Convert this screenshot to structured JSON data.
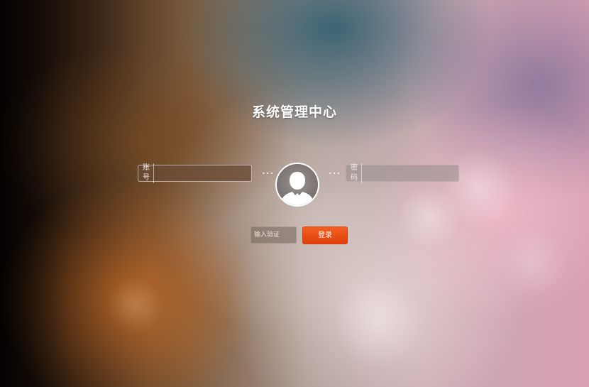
{
  "page": {
    "title": "系统管理中心"
  },
  "login_form": {
    "username_label": "账号",
    "username_value": "",
    "password_label": "密码",
    "password_value": "",
    "separator_left": "•••",
    "separator_right": "•••",
    "avatar_icon": "user-silhouette-icon",
    "captcha_placeholder": "输入验证",
    "captcha_value": "",
    "login_button_label": "登录"
  },
  "colors": {
    "accent": "#e84e14",
    "text": "#ffffff"
  }
}
